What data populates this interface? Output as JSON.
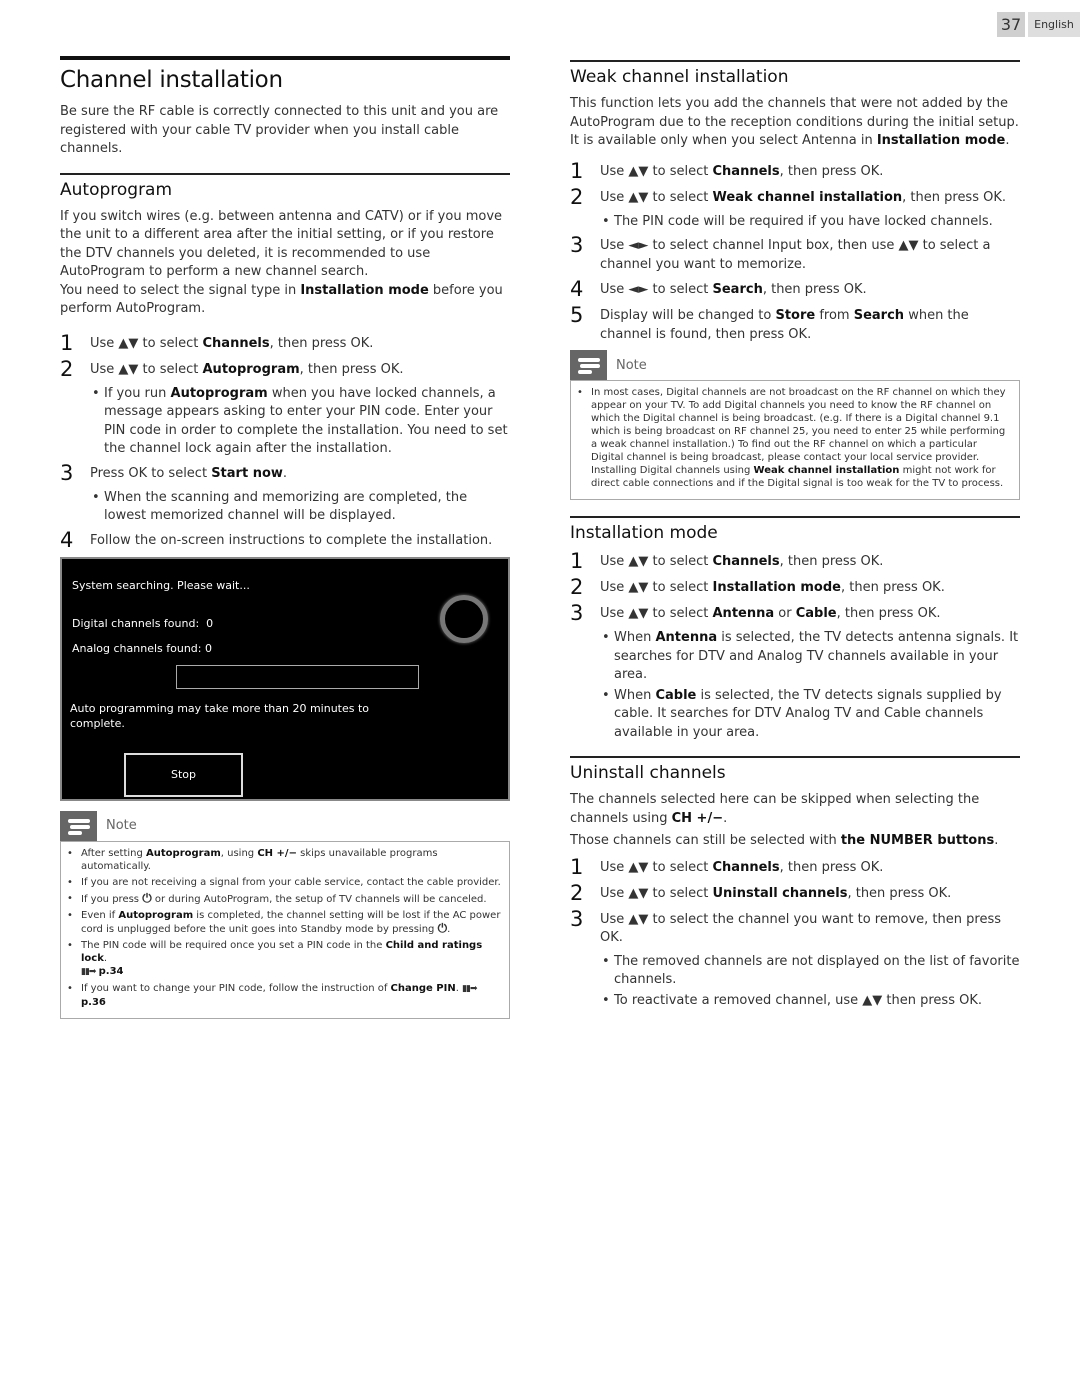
{
  "header": {
    "page_number": "37",
    "language": "English"
  },
  "left": {
    "title": "Channel installation",
    "intro": "Be sure the RF cable is correctly connected to this unit and you are registered with your cable TV provider when you install cable channels.",
    "autoprogram": {
      "heading": "Autoprogram",
      "para1": "If you switch wires (e.g. between antenna and CATV) or if you move the unit to a different area after the initial setting, or if you restore the DTV channels you deleted, it is recommended to use AutoProgram to perform a new channel search.",
      "para2_a": "You need to select the signal type in ",
      "para2_b": "Installation mode",
      "para2_c": " before you perform AutoProgram.",
      "steps": [
        {
          "num": "1",
          "a": "Use ▲▼ to select ",
          "b": "Channels",
          "c": ", then press OK."
        },
        {
          "num": "2",
          "a": "Use ▲▼ to select ",
          "b": "Autoprogram",
          "c": ", then press OK."
        },
        {
          "num": "3",
          "a": "Press OK to select ",
          "b": "Start now",
          "c": "."
        },
        {
          "num": "4",
          "a": "Follow the on-screen instructions to complete the installation.",
          "b": "",
          "c": ""
        }
      ],
      "step2_bullet_a": "If you run ",
      "step2_bullet_b": "Autoprogram",
      "step2_bullet_c": " when you have locked channels, a message appears asking to enter your PIN code. Enter your PIN code in order to complete the installation. You need to set the channel lock again after the installation.",
      "step3_bullet": "When the scanning and memorizing are completed, the lowest memorized channel will be displayed."
    },
    "tv_screen": {
      "status": "System searching. Please wait...",
      "digital_label": "Digital channels found:",
      "digital_value": "0",
      "analog_label": "Analog channels found:",
      "analog_value": "0",
      "progress_percent": 0,
      "message_line1": "Auto programming may take more than 20 minutes to",
      "message_line2": "complete.",
      "stop_label": "Stop"
    },
    "note": {
      "label": "Note",
      "items": [
        {
          "a": "After setting ",
          "b": "Autoprogram",
          "c": ", using ",
          "d": "CH +/−",
          "e": " skips unavailable programs automatically."
        },
        {
          "a": "If you are not receiving a signal from your cable service, contact the cable provider."
        },
        {
          "a": "If you press ",
          "icon": "⏻",
          "b": " or during AutoProgram, the setup of TV channels will be canceled."
        },
        {
          "a": "Even if ",
          "b": "Autoprogram",
          "c": " is completed, the channel setting will be lost if the AC power cord is unplugged before the unit goes into Standby mode by pressing ",
          "icon": "⏻",
          "d": "."
        },
        {
          "a": "The PIN code will be required once you set a PIN code in the ",
          "b": "Child and ratings lock",
          "c": ".",
          "ref": "p.34"
        },
        {
          "a": "If you want to change your PIN code, follow the instruction of ",
          "b": "Change PIN",
          "c": ".",
          "ref": "p.36"
        }
      ]
    }
  },
  "right": {
    "weak": {
      "heading": "Weak channel installation",
      "intro_a": "This function lets you add the channels that were not added by the AutoProgram due to the reception conditions during the initial setup. It is available only when you select Antenna in ",
      "intro_b": "Installation mode",
      "intro_c": ".",
      "step1": {
        "num": "1",
        "a": "Use ▲▼ to select ",
        "b": "Channels",
        "c": ", then press OK."
      },
      "step2": {
        "num": "2",
        "a": "Use ▲▼ to select ",
        "b": "Weak channel installation",
        "c": ", then press OK."
      },
      "step2_bullet": "The PIN code will be required if you have locked channels.",
      "step3": {
        "num": "3",
        "a": "Use ◄► to select channel Input box, then use ▲▼ to select a channel you want to memorize."
      },
      "step4": {
        "num": "4",
        "a": "Use ◄► to select ",
        "b": "Search",
        "c": ", then press OK."
      },
      "step5": {
        "num": "5",
        "a": "Display will be changed to ",
        "b": "Store",
        "c": " from ",
        "d": "Search",
        "e": " when the channel is found, then press OK."
      },
      "note": {
        "label": "Note",
        "p1": "In most cases, Digital channels are not broadcast on the RF channel on which they appear on your TV. To add Digital channels you need to know the RF channel on which the Digital channel is being broadcast. (e.g. If there is a Digital channel 9.1 which is being broadcast on RF channel 25, you need to enter 25 while performing a weak channel installation.) To find out the RF channel on which a particular Digital channel is being broadcast, please contact your local service provider.",
        "p2_a": "Installing Digital channels using ",
        "p2_b": "Weak channel installation",
        "p2_c": " might not work for direct cable connections and if the Digital signal is too weak for the TV to process."
      }
    },
    "install_mode": {
      "heading": "Installation mode",
      "step1": {
        "num": "1",
        "a": "Use ▲▼ to select ",
        "b": "Channels",
        "c": ", then press OK."
      },
      "step2": {
        "num": "2",
        "a": "Use ▲▼ to select ",
        "b": "Installation mode",
        "c": ", then press OK."
      },
      "step3": {
        "num": "3",
        "a": "Use ▲▼ to select ",
        "b": "Antenna",
        "c": " or ",
        "d": "Cable",
        "e": ", then press OK."
      },
      "bullet1": {
        "a": "When ",
        "b": "Antenna",
        "c": " is selected, the TV detects antenna signals. It searches for DTV and Analog TV channels available in your area."
      },
      "bullet2": {
        "a": "When ",
        "b": "Cable",
        "c": " is selected, the TV detects signals supplied by cable. It searches for DTV Analog TV and Cable channels available in your area."
      }
    },
    "uninstall": {
      "heading": "Uninstall channels",
      "p1_a": "The channels selected here can be skipped when selecting the channels using ",
      "p1_b": "CH +/−",
      "p1_c": ".",
      "p2_a": "Those channels can still be selected with ",
      "p2_b": "the NUMBER buttons",
      "p2_c": ".",
      "step1": {
        "num": "1",
        "a": "Use ▲▼ to select ",
        "b": "Channels",
        "c": ", then press OK."
      },
      "step2": {
        "num": "2",
        "a": "Use ▲▼ to select ",
        "b": "Uninstall channels",
        "c": ", then press OK."
      },
      "step3": {
        "num": "3",
        "a": "Use ▲▼ to select the channel you want to remove, then press OK."
      },
      "bullet1": "The removed channels are not displayed on the list of favorite channels.",
      "bullet2": "To reactivate a removed channel, use ▲▼ then press OK."
    }
  }
}
